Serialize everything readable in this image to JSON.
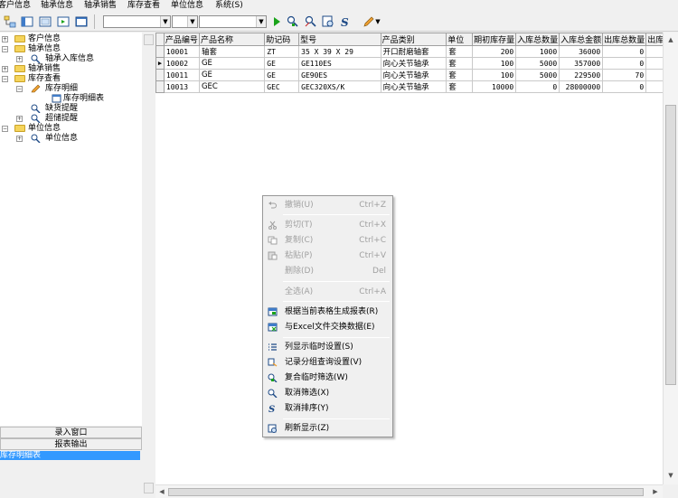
{
  "menubar": {
    "items": [
      "客户信息",
      "轴承信息",
      "轴承销售",
      "库存查看",
      "单位信息",
      "系统(S)"
    ]
  },
  "tree": {
    "nodes": [
      {
        "label": "客户信息",
        "level": 0,
        "expanded": false,
        "icon": "folder-icon"
      },
      {
        "label": "轴承信息",
        "level": 0,
        "expanded": true,
        "icon": "folder-icon"
      },
      {
        "label": "轴承入库信息",
        "level": 1,
        "expanded": false,
        "icon": "wrench-icon"
      },
      {
        "label": "轴承销售",
        "level": 0,
        "expanded": false,
        "icon": "folder-icon"
      },
      {
        "label": "库存查看",
        "level": 0,
        "expanded": true,
        "icon": "folder-icon"
      },
      {
        "label": "库存明细",
        "level": 1,
        "expanded": true,
        "icon": "pencil-icon"
      },
      {
        "label": "库存明细表",
        "level": 2,
        "expanded": false,
        "icon": "table-icon"
      },
      {
        "label": "缺货提醒",
        "level": 1,
        "expanded": false,
        "icon": "wrench-icon"
      },
      {
        "label": "超储提醒",
        "level": 1,
        "expanded": false,
        "icon": "wrench-icon"
      },
      {
        "label": "单位信息",
        "level": 0,
        "expanded": true,
        "icon": "folder-icon"
      },
      {
        "label": "单位信息",
        "level": 1,
        "expanded": false,
        "icon": "wrench-icon"
      }
    ]
  },
  "bottom_panel": {
    "entry_button": "录入窗口",
    "report_button": "报表输出",
    "selected_item": "库存明细表"
  },
  "grid": {
    "columns": [
      "产品编号",
      "产品名称",
      "助记码",
      "型号",
      "产品类别",
      "单位",
      "期初库存量",
      "入库总数量",
      "入库总金额",
      "出库总数量",
      "出库"
    ],
    "rows": [
      [
        "10001",
        "轴套",
        "ZT",
        "35 X 39 X 29",
        "开口耐磨轴套",
        "套",
        "200",
        "1000",
        "36000",
        "0",
        ""
      ],
      [
        "10002",
        "GE",
        "GE",
        "GE110ES",
        "向心关节轴承",
        "套",
        "100",
        "5000",
        "357000",
        "0",
        ""
      ],
      [
        "10011",
        "GE",
        "GE",
        "GE90ES",
        "向心关节轴承",
        "套",
        "100",
        "5000",
        "229500",
        "70",
        ""
      ],
      [
        "10013",
        "GEC",
        "GEC",
        "GEC320XS/K",
        "向心关节轴承",
        "套",
        "10000",
        "0",
        "28000000",
        "0",
        ""
      ]
    ],
    "current_row": 1
  },
  "context_menu": {
    "items": [
      {
        "label": "撤销(U)",
        "shortcut": "Ctrl+Z",
        "enabled": false,
        "icon": "undo-icon"
      },
      {
        "label": "剪切(T)",
        "shortcut": "Ctrl+X",
        "enabled": false,
        "icon": "scissors-icon"
      },
      {
        "label": "复制(C)",
        "shortcut": "Ctrl+C",
        "enabled": false,
        "icon": "copy-icon"
      },
      {
        "label": "粘贴(P)",
        "shortcut": "Ctrl+V",
        "enabled": false,
        "icon": "paste-icon"
      },
      {
        "label": "删除(D)",
        "shortcut": "Del",
        "enabled": false,
        "icon": ""
      },
      {
        "label": "全选(A)",
        "shortcut": "Ctrl+A",
        "enabled": false,
        "icon": ""
      },
      {
        "label": "根据当前表格生成报表(R)",
        "shortcut": "",
        "enabled": true,
        "icon": "report-icon"
      },
      {
        "label": "与Excel文件交换数据(E)",
        "shortcut": "",
        "enabled": true,
        "icon": "excel-icon"
      },
      {
        "label": "列显示临时设置(S)",
        "shortcut": "",
        "enabled": true,
        "icon": "list-icon"
      },
      {
        "label": "记录分组查询设置(V)",
        "shortcut": "",
        "enabled": true,
        "icon": "group-icon"
      },
      {
        "label": "复合临时筛选(W)",
        "shortcut": "",
        "enabled": true,
        "icon": "filter-icon"
      },
      {
        "label": "取消筛选(X)",
        "shortcut": "",
        "enabled": true,
        "icon": "cancel-filter-icon"
      },
      {
        "label": "取消排序(Y)",
        "shortcut": "",
        "enabled": true,
        "icon": "sort-icon"
      },
      {
        "label": "刷新显示(Z)",
        "shortcut": "",
        "enabled": true,
        "icon": "refresh-icon"
      }
    ]
  },
  "colors": {
    "selection": "#3399ff",
    "folder": "#f5d45b",
    "run_green": "#1aa31a"
  }
}
